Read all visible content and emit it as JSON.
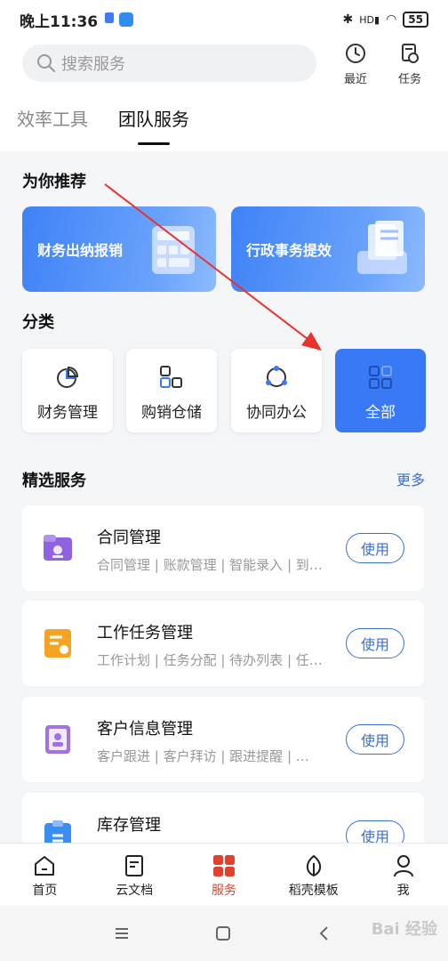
{
  "status_bar": {
    "time": "晚上11:36",
    "battery": "55",
    "network": "HD"
  },
  "search": {
    "placeholder": "搜索服务"
  },
  "top_buttons": {
    "recent": "最近",
    "tasks": "任务"
  },
  "tabs": [
    {
      "label": "效率工具",
      "active": false
    },
    {
      "label": "团队服务",
      "active": true
    }
  ],
  "recommend": {
    "title": "为你推荐",
    "cards": [
      {
        "label": "财务出纳报销"
      },
      {
        "label": "行政事务提效"
      }
    ]
  },
  "category": {
    "title": "分类",
    "items": [
      {
        "label": "财务管理",
        "icon": "pie-chart-icon"
      },
      {
        "label": "购销仓储",
        "icon": "shapes-icon"
      },
      {
        "label": "协同办公",
        "icon": "share-circle-icon"
      },
      {
        "label": "全部",
        "icon": "grid-icon",
        "active": true
      }
    ]
  },
  "featured": {
    "title": "精选服务",
    "more": "更多",
    "use_label": "使用",
    "items": [
      {
        "name": "合同管理",
        "desc": "合同管理 | 账款管理 | 智能录入 | 到…",
        "color": "#8e62e0"
      },
      {
        "name": "工作任务管理",
        "desc": "工作计划 | 任务分配 | 待办列表 | 任…",
        "color": "#f4a422"
      },
      {
        "name": "客户信息管理",
        "desc": "客户跟进 | 客户拜访 | 跟进提醒 | …",
        "color": "#a172e6"
      },
      {
        "name": "库存管理",
        "desc": "",
        "color": "#3a8df2"
      }
    ]
  },
  "bottom_nav": [
    {
      "label": "首页",
      "icon": "home-icon",
      "active": false
    },
    {
      "label": "云文档",
      "icon": "document-icon",
      "active": false
    },
    {
      "label": "服务",
      "icon": "grid-icon",
      "active": true
    },
    {
      "label": "稻壳模板",
      "icon": "leaf-icon",
      "active": false
    },
    {
      "label": "我",
      "icon": "user-icon",
      "active": false
    }
  ],
  "watermark": "Bai 经验",
  "colors": {
    "accent": "#3a79f6",
    "active_nav": "#e2412d",
    "annotation_arrow": "#e8322c"
  }
}
